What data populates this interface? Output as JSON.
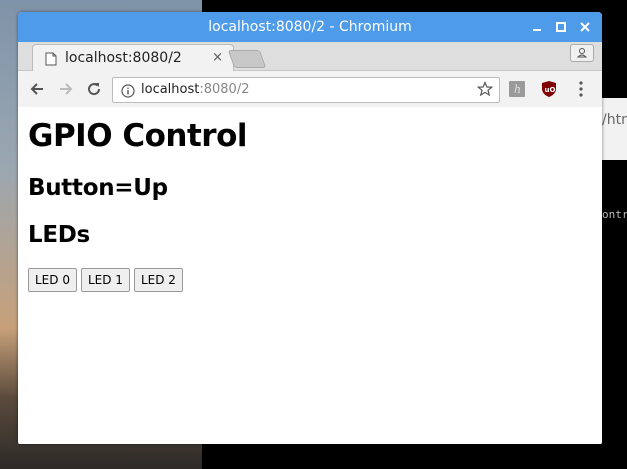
{
  "window": {
    "title": "localhost:8080/2 - Chromium",
    "controls": [
      "minimize",
      "maximize",
      "close"
    ]
  },
  "tab": {
    "title": "localhost:8080/2",
    "close_glyph": "×"
  },
  "omnibox": {
    "host": "localhost",
    "path": ":8080/2"
  },
  "background": {
    "url_fragment": "/htn",
    "terminal_fragment": "ontr"
  },
  "page": {
    "heading": "GPIO Control",
    "button_status": "Button=Up",
    "leds_heading": "LEDs",
    "buttons": [
      "LED 0",
      "LED 1",
      "LED 2"
    ]
  },
  "icons": {
    "titlebar": [
      "minimize-icon",
      "maximize-icon",
      "close-icon"
    ],
    "toolbar": [
      "back-arrow-icon",
      "forward-arrow-icon",
      "reload-icon",
      "info-icon",
      "star-icon",
      "extension-h-icon",
      "ublock-icon",
      "menu-dots-icon"
    ]
  },
  "colors": {
    "titlebar": "#4d9be9",
    "ublock": "#800000"
  }
}
